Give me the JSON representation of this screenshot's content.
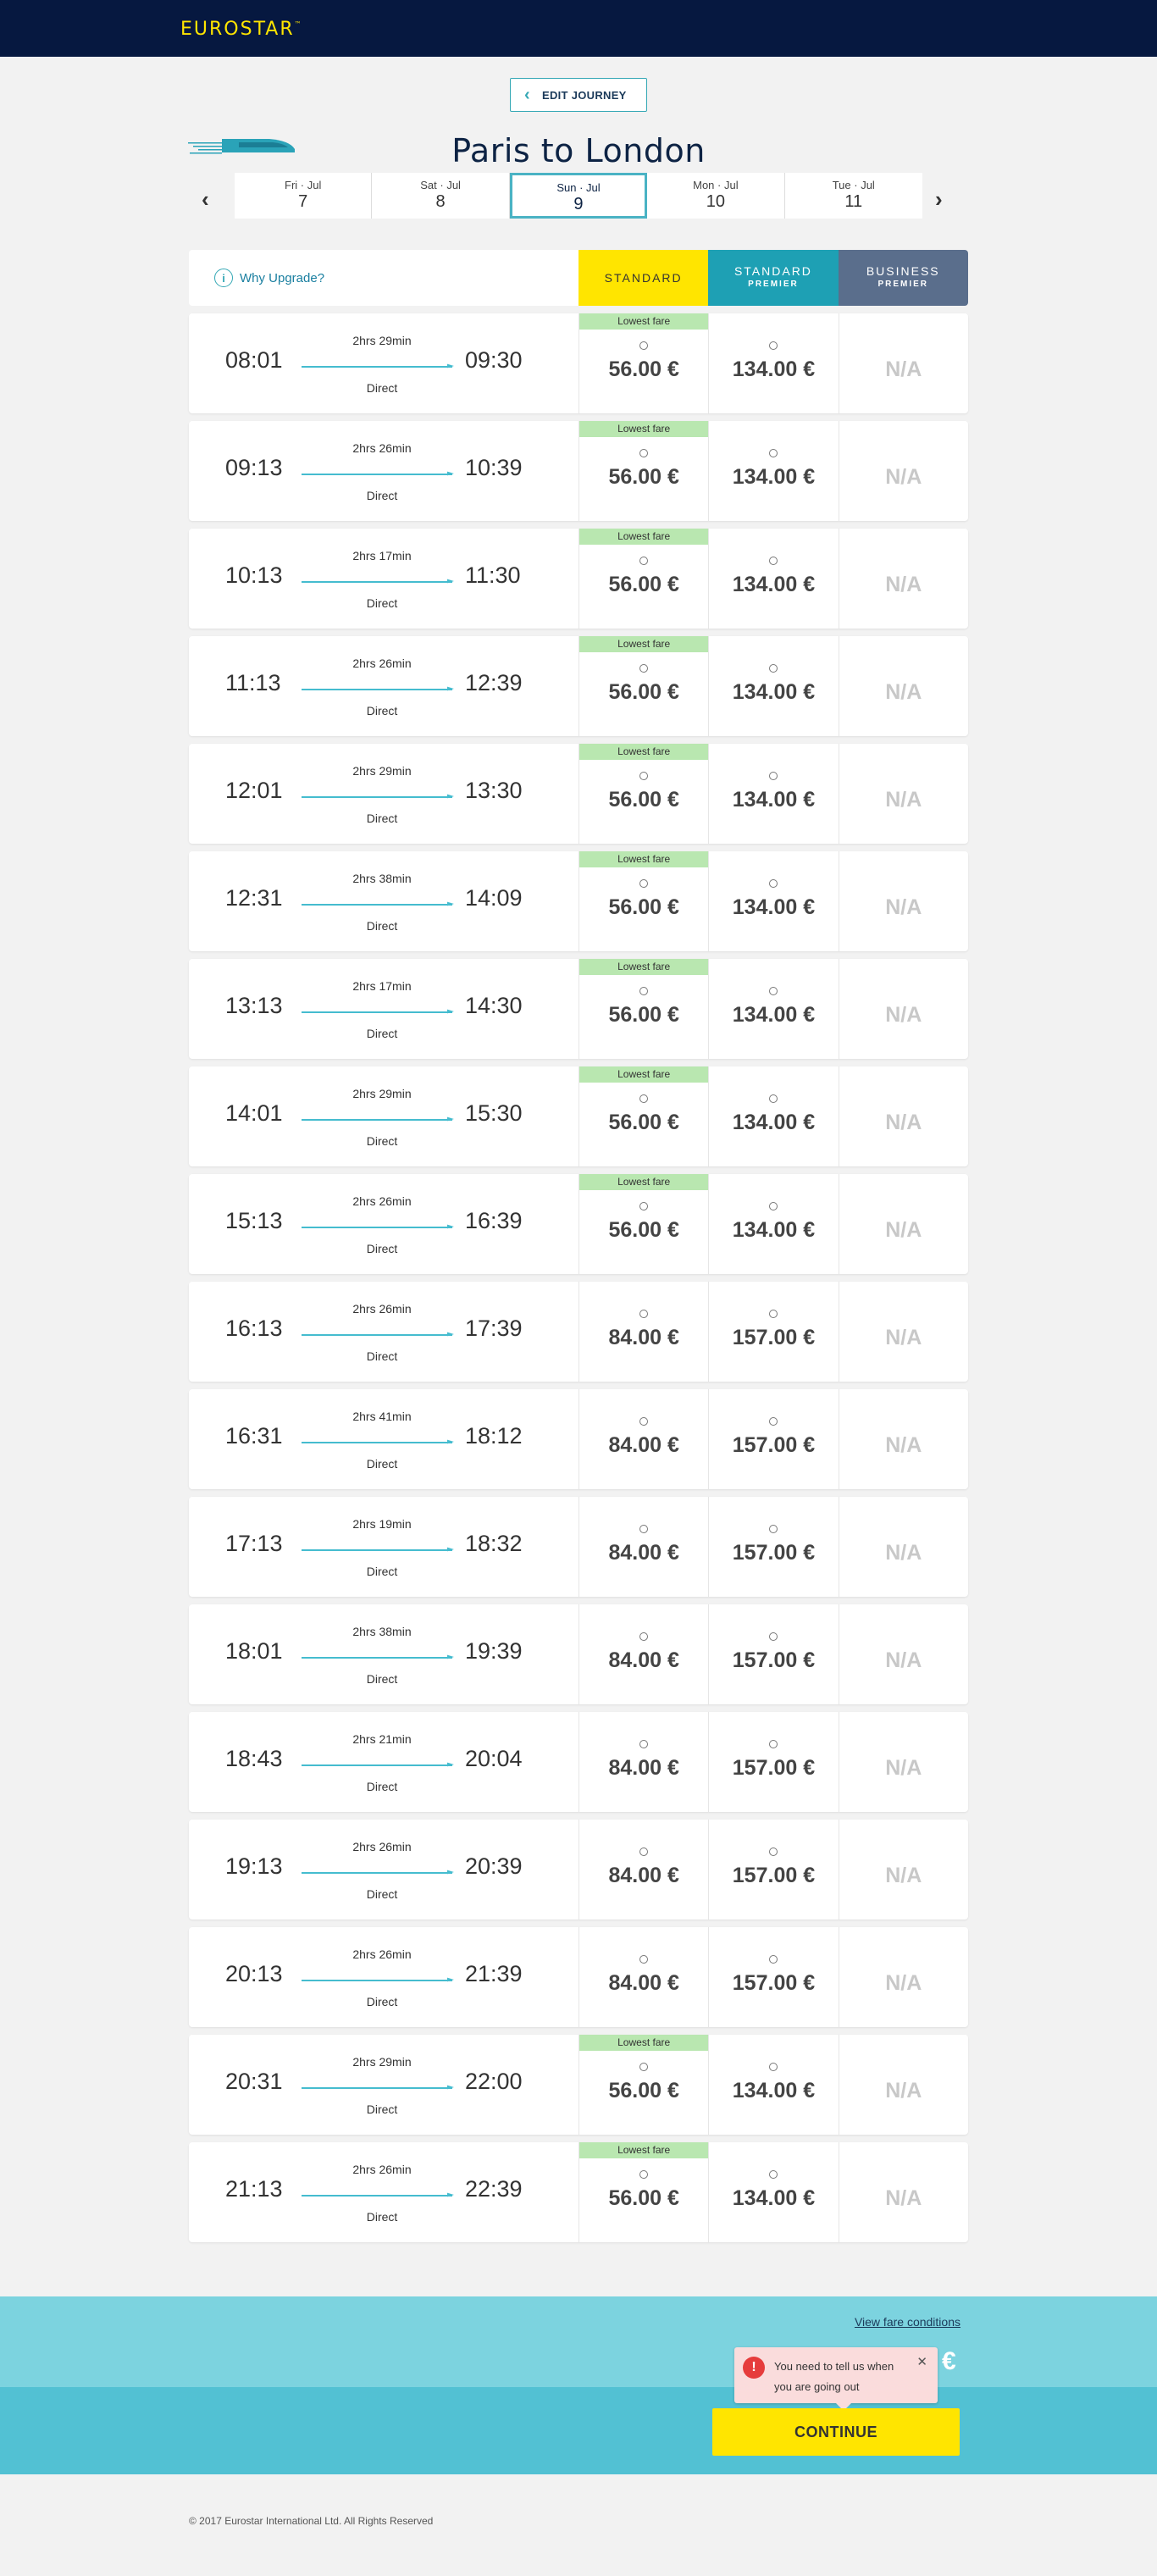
{
  "header": {
    "logo": "EUROSTAR",
    "logo_tm": "™"
  },
  "edit_journey": {
    "label": "EDIT JOURNEY"
  },
  "page_title": "Paris to London",
  "dates": [
    {
      "dow": "Fri",
      "month": "Jul",
      "day": "7",
      "active": false
    },
    {
      "dow": "Sat",
      "month": "Jul",
      "day": "8",
      "active": false
    },
    {
      "dow": "Sun",
      "month": "Jul",
      "day": "9",
      "active": true
    },
    {
      "dow": "Mon",
      "month": "Jul",
      "day": "10",
      "active": false
    },
    {
      "dow": "Tue",
      "month": "Jul",
      "day": "11",
      "active": false
    }
  ],
  "why_upgrade": "Why Upgrade?",
  "classes": {
    "standard": "STANDARD",
    "standard_premier_top": "STANDARD",
    "standard_premier_sub": "PREMIER",
    "business_premier_top": "BUSINESS",
    "business_premier_sub": "PREMIER"
  },
  "lowest_fare_label": "Lowest fare",
  "direct_label": "Direct",
  "na_label": "N/A",
  "journeys": [
    {
      "dep": "08:01",
      "arr": "09:30",
      "dur": "2hrs 29min",
      "std": "56.00 €",
      "sp": "134.00 €",
      "lowest": true
    },
    {
      "dep": "09:13",
      "arr": "10:39",
      "dur": "2hrs 26min",
      "std": "56.00 €",
      "sp": "134.00 €",
      "lowest": true
    },
    {
      "dep": "10:13",
      "arr": "11:30",
      "dur": "2hrs 17min",
      "std": "56.00 €",
      "sp": "134.00 €",
      "lowest": true
    },
    {
      "dep": "11:13",
      "arr": "12:39",
      "dur": "2hrs 26min",
      "std": "56.00 €",
      "sp": "134.00 €",
      "lowest": true
    },
    {
      "dep": "12:01",
      "arr": "13:30",
      "dur": "2hrs 29min",
      "std": "56.00 €",
      "sp": "134.00 €",
      "lowest": true
    },
    {
      "dep": "12:31",
      "arr": "14:09",
      "dur": "2hrs 38min",
      "std": "56.00 €",
      "sp": "134.00 €",
      "lowest": true
    },
    {
      "dep": "13:13",
      "arr": "14:30",
      "dur": "2hrs 17min",
      "std": "56.00 €",
      "sp": "134.00 €",
      "lowest": true
    },
    {
      "dep": "14:01",
      "arr": "15:30",
      "dur": "2hrs 29min",
      "std": "56.00 €",
      "sp": "134.00 €",
      "lowest": true
    },
    {
      "dep": "15:13",
      "arr": "16:39",
      "dur": "2hrs 26min",
      "std": "56.00 €",
      "sp": "134.00 €",
      "lowest": true
    },
    {
      "dep": "16:13",
      "arr": "17:39",
      "dur": "2hrs 26min",
      "std": "84.00 €",
      "sp": "157.00 €",
      "lowest": false
    },
    {
      "dep": "16:31",
      "arr": "18:12",
      "dur": "2hrs 41min",
      "std": "84.00 €",
      "sp": "157.00 €",
      "lowest": false
    },
    {
      "dep": "17:13",
      "arr": "18:32",
      "dur": "2hrs 19min",
      "std": "84.00 €",
      "sp": "157.00 €",
      "lowest": false
    },
    {
      "dep": "18:01",
      "arr": "19:39",
      "dur": "2hrs 38min",
      "std": "84.00 €",
      "sp": "157.00 €",
      "lowest": false
    },
    {
      "dep": "18:43",
      "arr": "20:04",
      "dur": "2hrs 21min",
      "std": "84.00 €",
      "sp": "157.00 €",
      "lowest": false
    },
    {
      "dep": "19:13",
      "arr": "20:39",
      "dur": "2hrs 26min",
      "std": "84.00 €",
      "sp": "157.00 €",
      "lowest": false
    },
    {
      "dep": "20:13",
      "arr": "21:39",
      "dur": "2hrs 26min",
      "std": "84.00 €",
      "sp": "157.00 €",
      "lowest": false
    },
    {
      "dep": "20:31",
      "arr": "22:00",
      "dur": "2hrs 29min",
      "std": "56.00 €",
      "sp": "134.00 €",
      "lowest": true
    },
    {
      "dep": "21:13",
      "arr": "22:39",
      "dur": "2hrs 26min",
      "std": "56.00 €",
      "sp": "134.00 €",
      "lowest": true
    }
  ],
  "footer": {
    "fare_conditions": "View fare conditions",
    "euro_symbol": "€",
    "tooltip": "You need to tell us when you are going out",
    "tooltip_close": "✕",
    "continue": "CONTINUE",
    "copyright": "© 2017 Eurostar International Ltd. All Rights Reserved"
  },
  "colors": {
    "topbar": "#061840",
    "brand_yellow": "#ffe500",
    "standard_premier": "#1ea0b4",
    "business_premier": "#5a6e8c",
    "lowest_fare": "#b9e7b0",
    "footer_light": "#7cd3df",
    "footer_dark": "#52c1d3"
  }
}
